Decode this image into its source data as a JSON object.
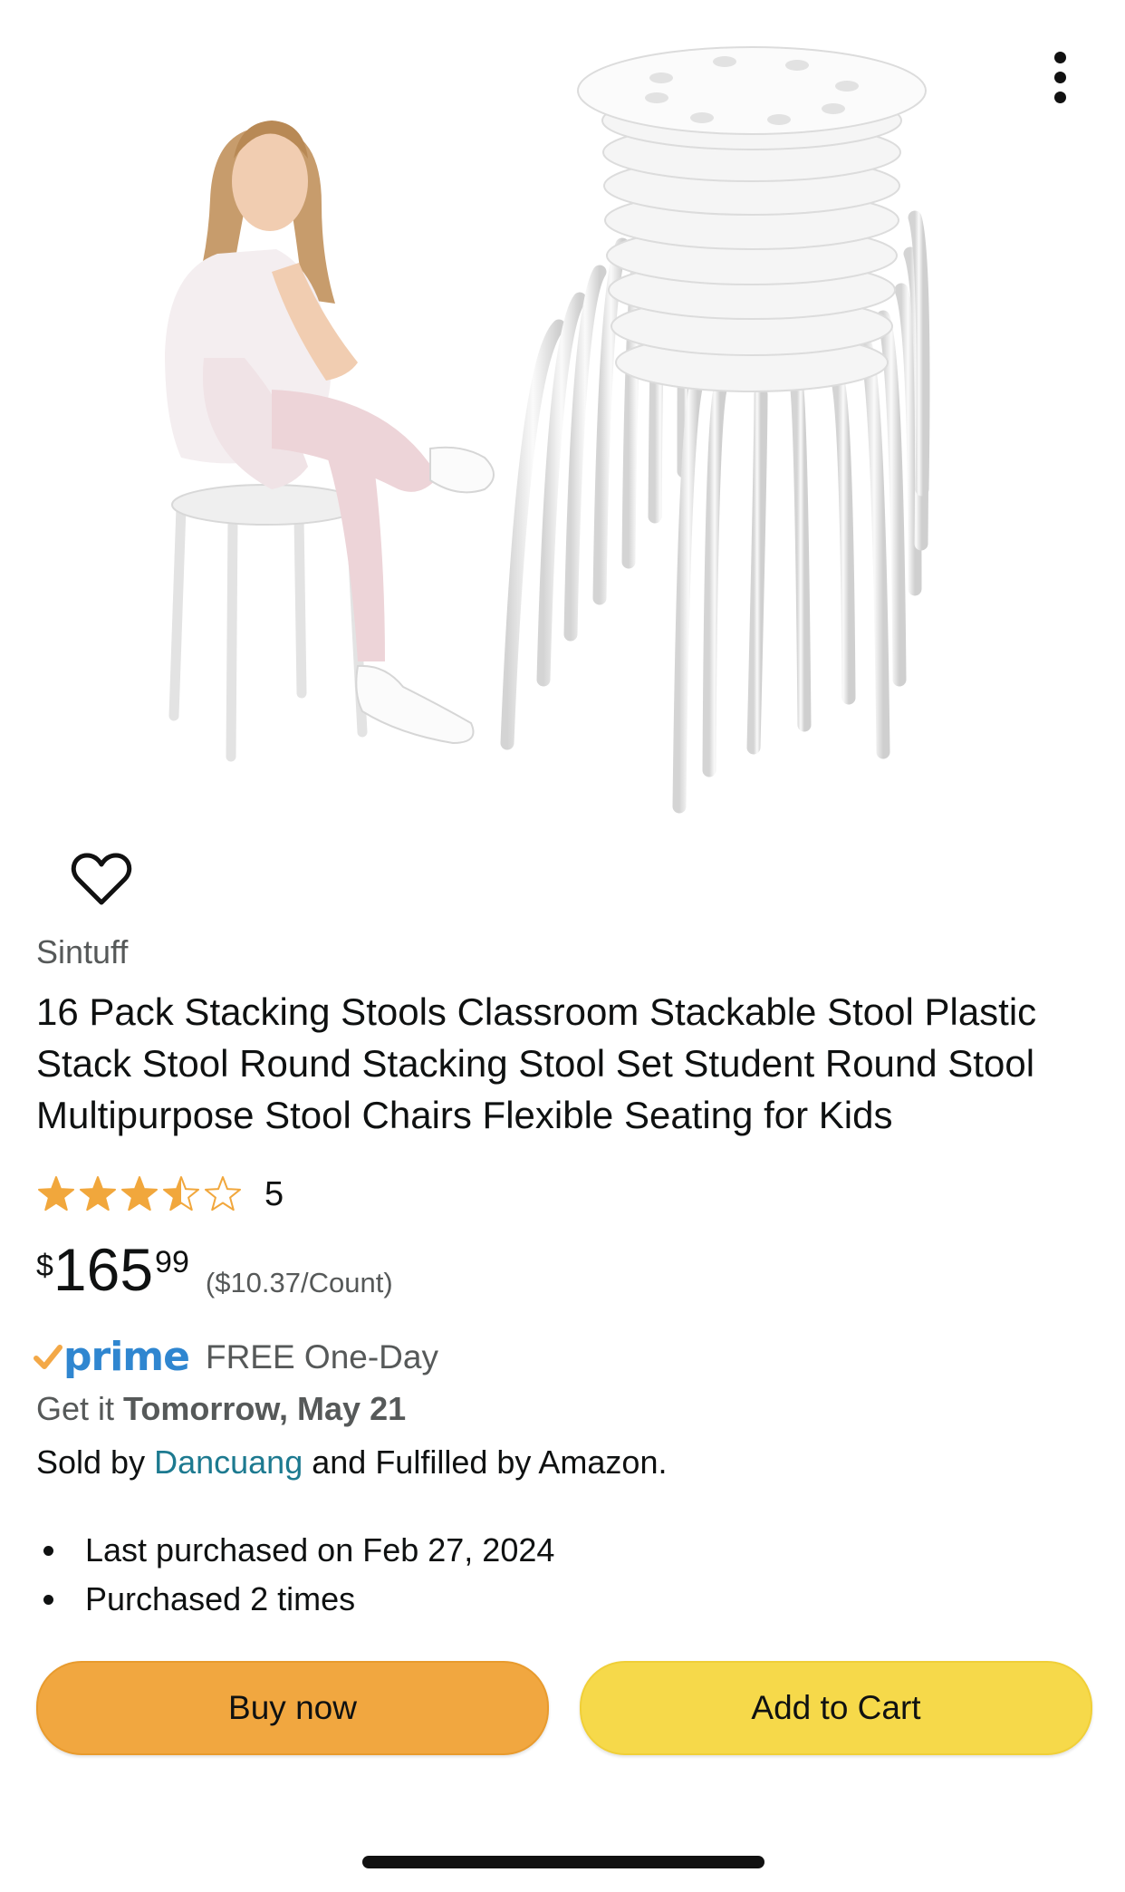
{
  "product": {
    "brand": "Sintuff",
    "title": "16 Pack Stacking Stools Classroom Stackable Stool Plastic Stack Stool Round Stacking Stool Set Student Round Stool Multipurpose Stool Chairs Flexible Seating for Kids",
    "rating_stars": 3.5,
    "rating_count": "5",
    "price_symbol": "$",
    "price_whole": "165",
    "price_fraction": "99",
    "unit_price": "($10.37/Count)"
  },
  "delivery": {
    "prime_label": "prime",
    "prime_text": "FREE One-Day",
    "get_it_prefix": "Get it",
    "get_it_date": "Tomorrow, May 21",
    "sold_by_prefix": "Sold by",
    "seller": "Dancuang",
    "sold_by_suffix": "and Fulfilled by Amazon."
  },
  "history": {
    "last_purchased": "Last purchased on Feb 27, 2024",
    "times": "Purchased 2 times"
  },
  "buttons": {
    "buy_now": "Buy now",
    "add_to_cart": "Add to Cart"
  },
  "colors": {
    "buy_now": "#f1a740",
    "add_to_cart": "#f6d94a",
    "star": "#f1a73c",
    "link": "#1d7a90",
    "prime_blue": "#2f86d0",
    "prime_check": "#f3a847"
  },
  "icons": {
    "more": "more-vertical-icon",
    "wishlist": "heart-icon",
    "prime_check": "checkmark-icon"
  }
}
